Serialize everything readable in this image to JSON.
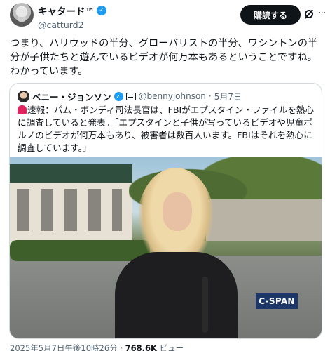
{
  "author": {
    "display_name": "キャタード™",
    "verified_glyph": "✓",
    "handle": "@catturd2",
    "avatar_icon": "avatar-cat-icon"
  },
  "actions": {
    "subscribe_label": "購読する",
    "grok_icon": "grok-icon",
    "more_glyph": "···"
  },
  "tweet": {
    "text": "つまり、ハリウッドの半分、グローバリストの半分、ワシントンの半分が子供たちと遊んでいるビデオが何万本もあるということですね。わかっています。"
  },
  "quote": {
    "display_name": "ベニー・ジョンソン",
    "verified_glyph": "✓",
    "handle": "@bennyjohnson",
    "separator": "·",
    "date": "5月7日",
    "text": "速報：パム・ボンディ司法長官は、FBIがエプスタイン・ファイルを熱心に調査していると発表。「エプスタインと子供が写っているビデオや児童ポルノのビデオが何万本もあり、被害者は数百人います。FBIはそれを熱心に調査しています。」",
    "alert_icon": "siren-icon",
    "video_watermark": "C-SPAN"
  },
  "meta": {
    "timestamp": "2025年5月7日午後10時26分",
    "separator": " · ",
    "views_count": "768.6K",
    "views_label": " ビュー"
  },
  "colors": {
    "accent_blue": "#1d9bf0",
    "text_primary": "#0f1419",
    "text_secondary": "#536471",
    "border": "#cfd9de",
    "button_bg": "#0f1419"
  }
}
